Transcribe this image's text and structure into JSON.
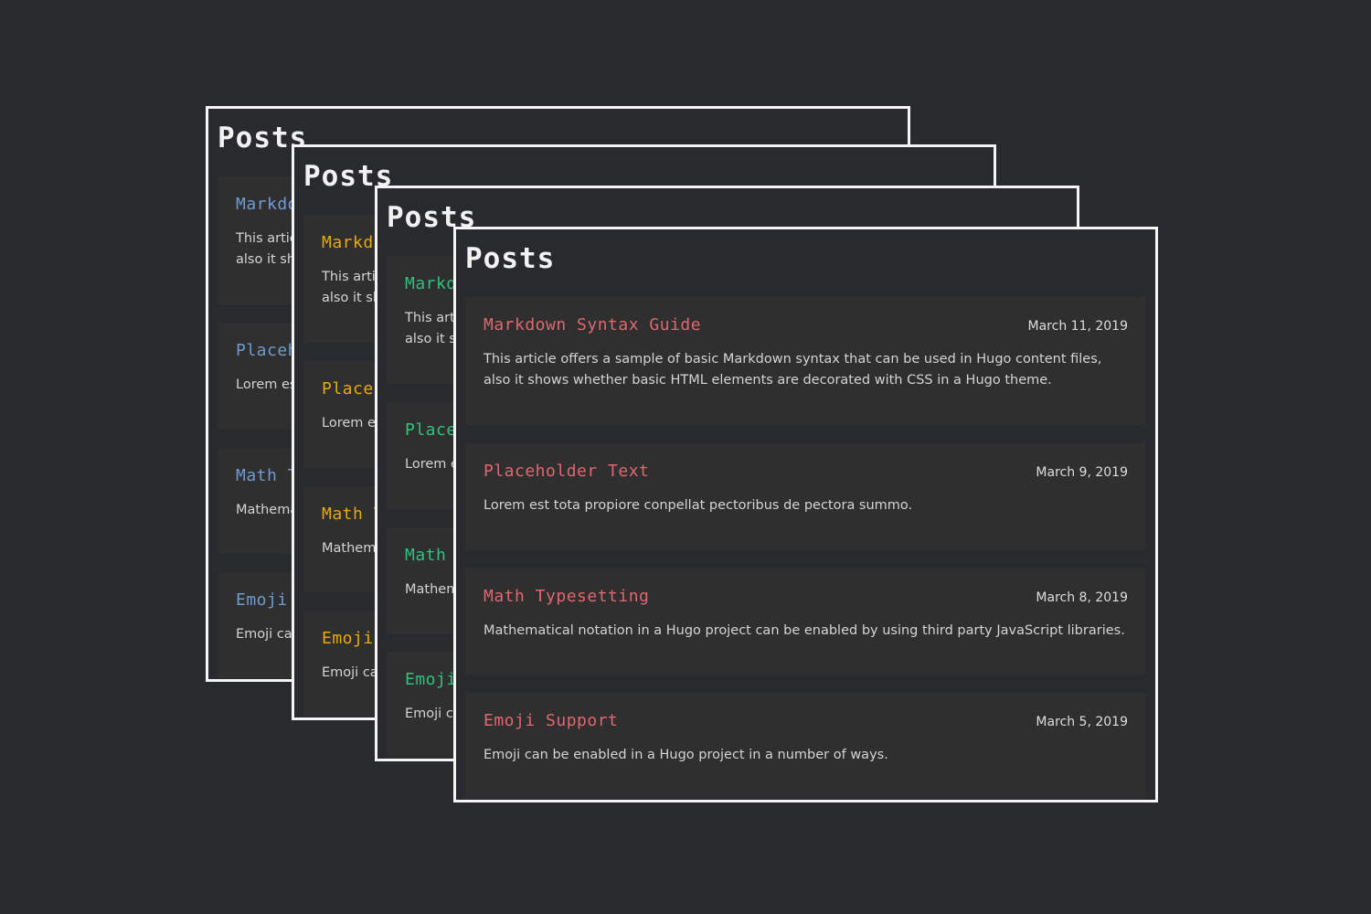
{
  "page_title": "Posts",
  "posts": [
    {
      "title": "Markdown Syntax Guide",
      "date": "March 11, 2019",
      "summary": "This article offers a sample of basic Markdown syntax that can be used in Hugo content files, also it shows whether basic HTML elements are decorated with CSS in a Hugo theme."
    },
    {
      "title": "Placeholder Text",
      "date": "March 9, 2019",
      "summary": "Lorem est tota propiore conpellat pectoribus de pectora summo."
    },
    {
      "title": "Math Typesetting",
      "date": "March 8, 2019",
      "summary": "Mathematical notation in a Hugo project can be enabled by using third party JavaScript libraries."
    },
    {
      "title": "Emoji Support",
      "date": "March 5, 2019",
      "summary": "Emoji can be enabled in a Hugo project in a number of ways."
    }
  ],
  "theme_variants": [
    {
      "accent": "#6e9bd1"
    },
    {
      "accent": "#e8a90c"
    },
    {
      "accent": "#2ec27e"
    },
    {
      "accent": "#e06670"
    }
  ],
  "colors": {
    "background": "#292a2e",
    "card": "#2f2f2f",
    "border": "#f4f4f4"
  }
}
